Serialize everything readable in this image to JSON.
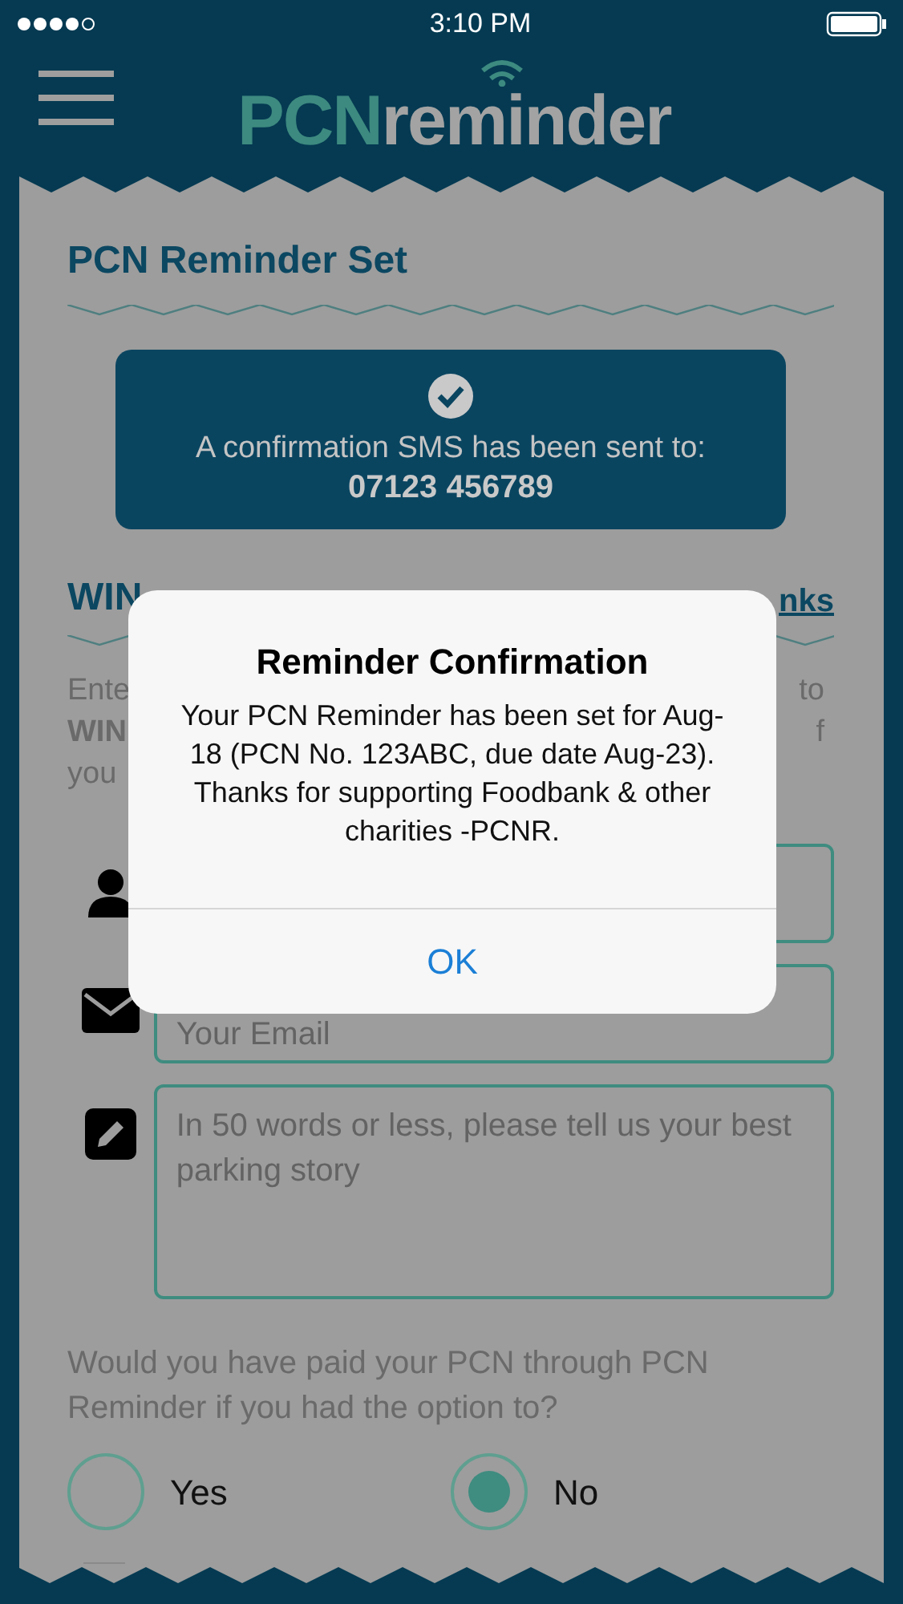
{
  "status_bar": {
    "time": "3:10 PM"
  },
  "header": {
    "logo_left": "PCN",
    "logo_right": "reminder"
  },
  "card": {
    "title": "PCN Reminder Set",
    "confirmation": {
      "message": "A confirmation SMS has been sent to:",
      "phone": "07123 456789"
    },
    "win_heading": "WIN",
    "link": "nks",
    "intro_left": [
      "Ente",
      "WIN",
      "you"
    ],
    "intro_right": [
      "to",
      "f"
    ],
    "fields": [
      {
        "kind": "name"
      },
      {
        "kind": "email",
        "placeholder": "Your Email"
      },
      {
        "kind": "story",
        "placeholder": "In 50 words or less, please tell us your best parking story"
      }
    ],
    "question": "Would you have paid your PCN through PCN Reminder if you had the option to?",
    "options": [
      {
        "label": "Yes",
        "selected": false
      },
      {
        "label": "No",
        "selected": true
      }
    ]
  },
  "dialog": {
    "title": "Reminder Confirmation",
    "message": "Your PCN Reminder has been set for Aug-18 (PCN No. 123ABC, due date Aug-23). Thanks for supporting Foodbank & other charities -PCNR.",
    "button": "OK"
  }
}
